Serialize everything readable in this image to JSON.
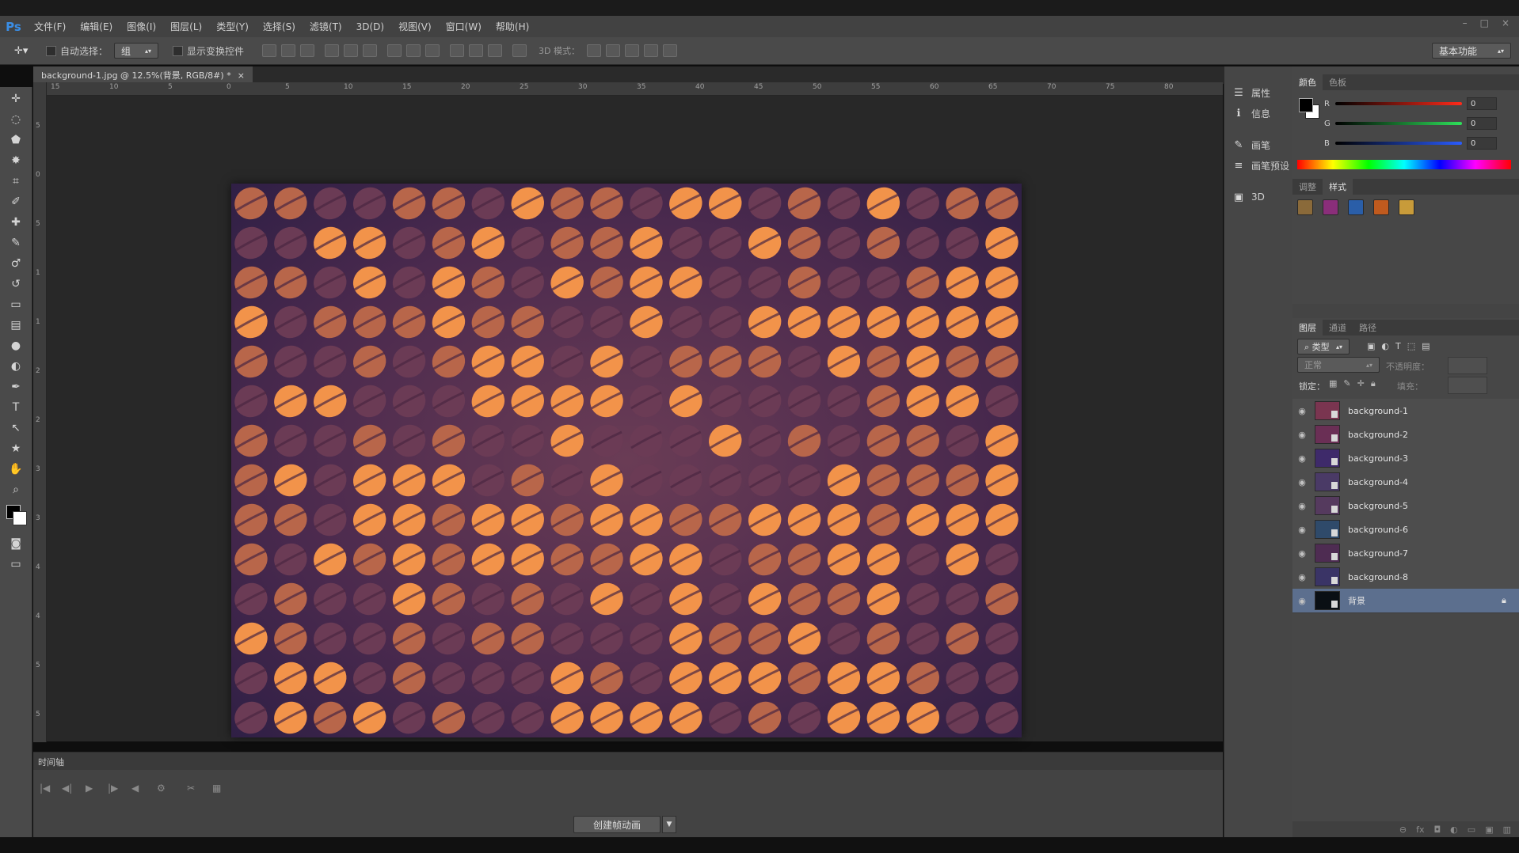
{
  "app": {
    "logo": "Ps",
    "window_controls": [
      "–",
      "□",
      "×"
    ]
  },
  "menu": [
    "文件(F)",
    "编辑(E)",
    "图像(I)",
    "图层(L)",
    "类型(Y)",
    "选择(S)",
    "滤镜(T)",
    "3D(D)",
    "视图(V)",
    "窗口(W)",
    "帮助(H)"
  ],
  "options": {
    "auto_select_label": "自动选择：",
    "auto_select_value": "组",
    "show_transform_label": "显示变换控件",
    "mode_3d_label": "3D 模式：",
    "workspace": "基本功能"
  },
  "document": {
    "tab_title": "background-1.jpg @ 12.5%(背景, RGB/8#) *",
    "close": "×",
    "ruler_h": [
      "15",
      "10",
      "5",
      "0",
      "5",
      "10",
      "15",
      "20",
      "25",
      "30",
      "35",
      "40",
      "45",
      "50",
      "55",
      "60",
      "65",
      "70",
      "75",
      "80"
    ],
    "ruler_v": [
      "5",
      "0",
      "5",
      "1",
      "1",
      "2",
      "2",
      "3",
      "3",
      "4",
      "4",
      "5",
      "5"
    ]
  },
  "timeline": {
    "label": "时间轴",
    "create_button": "创建帧动画",
    "controls": [
      "|◀",
      "◀|",
      "▶",
      "|▶",
      "◀",
      "⚙",
      "✂",
      "▦"
    ]
  },
  "mid_panel": {
    "items": [
      {
        "icon": "properties-icon",
        "glyph": "☰",
        "label": "属性"
      },
      {
        "icon": "info-icon",
        "glyph": "ℹ",
        "label": "信息"
      },
      {
        "icon": "brush-icon",
        "glyph": "✎",
        "label": "画笔"
      },
      {
        "icon": "brush-preset-icon",
        "glyph": "≡",
        "label": "画笔预设"
      },
      {
        "icon": "3d-cube-icon",
        "glyph": "▣",
        "label": "3D"
      }
    ]
  },
  "color_panel": {
    "tabs": [
      "颜色",
      "色板"
    ],
    "channels": [
      {
        "label": "R",
        "value": "0",
        "color": "#d43a2a"
      },
      {
        "label": "G",
        "value": "0",
        "color": "#27a14a"
      },
      {
        "label": "B",
        "value": "0",
        "color": "#2f5fd0"
      }
    ]
  },
  "styles_panel": {
    "tabs": [
      "调整",
      "样式"
    ],
    "swatches": [
      "#8a6a3a",
      "#8a2e7a",
      "#2a5ea8",
      "#c05a1e",
      "#c89b3a"
    ]
  },
  "layers_panel": {
    "tabs": [
      "图层",
      "通道",
      "路径"
    ],
    "filter_label": "⌕ 类型",
    "blend_mode": "正常",
    "opacity_label": "不透明度：",
    "lock_label": "锁定：",
    "fill_label": "填充：",
    "layers": [
      {
        "name": "background-1",
        "thumb": "#7a3550",
        "selected": false,
        "locked": false
      },
      {
        "name": "background-2",
        "thumb": "#6a2f55",
        "selected": false,
        "locked": false
      },
      {
        "name": "background-3",
        "thumb": "#3e2a6a",
        "selected": false,
        "locked": false
      },
      {
        "name": "background-4",
        "thumb": "#4a3a66",
        "selected": false,
        "locked": false
      },
      {
        "name": "background-5",
        "thumb": "#553a5e",
        "selected": false,
        "locked": false
      },
      {
        "name": "background-6",
        "thumb": "#2f4a6a",
        "selected": false,
        "locked": false
      },
      {
        "name": "background-7",
        "thumb": "#4e2c52",
        "selected": false,
        "locked": false
      },
      {
        "name": "background-8",
        "thumb": "#3a3466",
        "selected": false,
        "locked": false
      },
      {
        "name": "背景",
        "thumb": "#0a0f14",
        "selected": true,
        "locked": true
      }
    ]
  },
  "tools": [
    "move-tool-icon",
    "lasso-icon",
    "polygon-lasso-icon",
    "magic-wand-icon",
    "crop-icon",
    "eyedropper-icon",
    "healing-icon",
    "brush-tool-icon",
    "stamp-icon",
    "history-brush-icon",
    "eraser-icon",
    "gradient-icon",
    "blur-icon",
    "dodge-icon",
    "pen-icon",
    "type-icon",
    "path-select-icon",
    "shape-icon",
    "hand-icon",
    "zoom-icon"
  ],
  "tool_glyphs": [
    "✛",
    "◌",
    "⬟",
    "✸",
    "⌗",
    "✐",
    "✚",
    "✎",
    "♂",
    "↺",
    "▭",
    "▤",
    "●",
    "◐",
    "✒",
    "T",
    "↖",
    "★",
    "✋",
    "⌕"
  ]
}
